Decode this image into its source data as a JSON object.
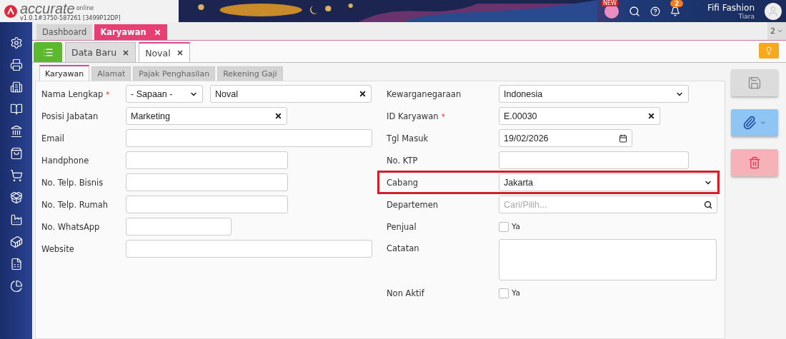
{
  "app": {
    "logo": "accurate",
    "logo_sub": "online",
    "version": "v1.0.1#3750-587261 [3499P12DP]"
  },
  "header": {
    "new_badge": "NEW",
    "notification_count": "2",
    "company": "Fifi Fashion",
    "user": "Tiara"
  },
  "window_tabs": [
    {
      "label": "Dashboard",
      "selected": false,
      "closable": false
    },
    {
      "label": "Karyawan",
      "selected": true,
      "closable": true
    }
  ],
  "window_count": "2",
  "doc_tabs": [
    {
      "label": "Data Baru",
      "selected": false
    },
    {
      "label": "Noval",
      "selected": true
    }
  ],
  "form_tabs": [
    {
      "label": "Karyawan",
      "selected": true
    },
    {
      "label": "Alamat",
      "selected": false
    },
    {
      "label": "Pajak Penghasilan",
      "selected": false
    },
    {
      "label": "Rekening Gaji",
      "selected": false
    }
  ],
  "left_fields": [
    {
      "label": "Nama Lengkap",
      "required_mark": "*",
      "inputs": [
        {
          "kind": "select",
          "value": "- Sapaan -"
        },
        {
          "kind": "text",
          "value": "Noval",
          "clearable": true
        }
      ]
    },
    {
      "label": "Posisi Jabatan",
      "inputs": [
        {
          "kind": "text",
          "value": "Marketing",
          "clearable": true
        }
      ]
    },
    {
      "label": "Email",
      "inputs": [
        {
          "kind": "text"
        }
      ]
    },
    {
      "label": "Handphone",
      "inputs": [
        {
          "kind": "text"
        }
      ]
    },
    {
      "label": "No. Telp. Bisnis",
      "inputs": [
        {
          "kind": "text"
        }
      ]
    },
    {
      "label": "No. Telp. Rumah",
      "inputs": [
        {
          "kind": "text"
        }
      ]
    },
    {
      "label": "No. WhatsApp",
      "inputs": [
        {
          "kind": "text"
        }
      ]
    },
    {
      "label": "Website",
      "inputs": [
        {
          "kind": "text"
        }
      ]
    }
  ],
  "right_fields": [
    {
      "label": "Kewarganegaraan",
      "inputs": [
        {
          "kind": "select",
          "value": "Indonesia"
        }
      ]
    },
    {
      "label": "ID Karyawan",
      "required_mark": "*",
      "inputs": [
        {
          "kind": "text",
          "value": "E.00030",
          "clearable": true
        }
      ]
    },
    {
      "label": "Tgl Masuk",
      "inputs": [
        {
          "kind": "date",
          "value": "19/02/2026"
        }
      ]
    },
    {
      "label": "No. KTP",
      "inputs": [
        {
          "kind": "text"
        }
      ]
    },
    {
      "label": "Cabang",
      "highlighted": true,
      "inputs": [
        {
          "kind": "select",
          "value": "Jakarta"
        }
      ]
    },
    {
      "label": "Departemen",
      "inputs": [
        {
          "kind": "search",
          "placeholder": "Cari/Pilih..."
        }
      ]
    },
    {
      "label": "Penjual",
      "inputs": [
        {
          "kind": "checkbox",
          "option": "Ya",
          "checked": false
        }
      ]
    },
    {
      "label": "Catatan",
      "inputs": [
        {
          "kind": "textarea"
        }
      ]
    },
    {
      "label": "Non Aktif",
      "inputs": [
        {
          "kind": "checkbox",
          "option": "Ya",
          "checked": false
        }
      ]
    }
  ]
}
